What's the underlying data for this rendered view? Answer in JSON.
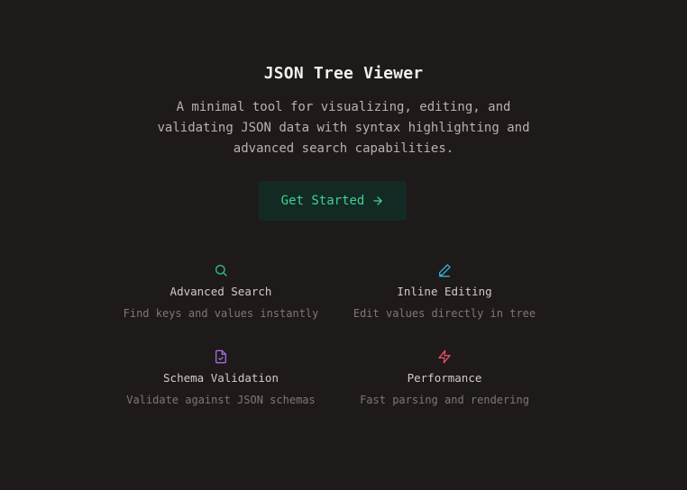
{
  "hero": {
    "title": "JSON Tree Viewer",
    "description": "A minimal tool for visualizing, editing, and validating JSON data with syntax highlighting and advanced search capabilities.",
    "cta_label": "Get Started",
    "cta_icon": "arrow-right-icon"
  },
  "features": [
    {
      "name": "Advanced Search",
      "description": "Find keys and values instantly",
      "icon": "search-icon",
      "color": "#2fbf8a"
    },
    {
      "name": "Inline Editing",
      "description": "Edit values directly in tree",
      "icon": "pencil-icon",
      "color": "#2fb0d8"
    },
    {
      "name": "Schema Validation",
      "description": "Validate against JSON schemas",
      "icon": "file-check-icon",
      "color": "#a46be0"
    },
    {
      "name": "Performance",
      "description": "Fast parsing and rendering",
      "icon": "zap-icon",
      "color": "#e0506a"
    }
  ],
  "colors": {
    "background": "#1e1a19",
    "accent": "#3fd192",
    "cta_background": "#132a24"
  }
}
